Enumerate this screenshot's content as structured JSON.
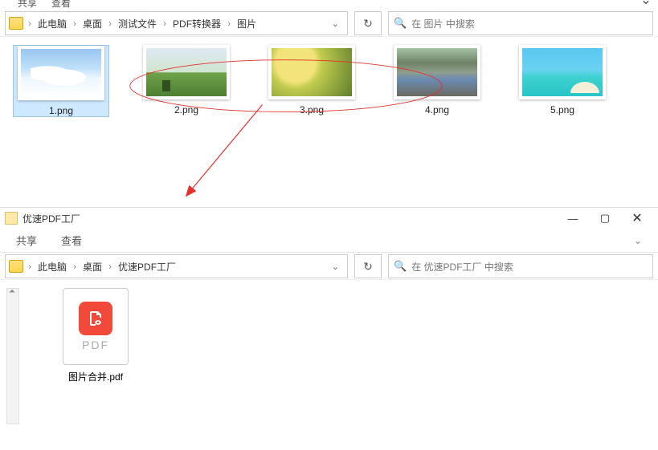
{
  "top": {
    "ribbonTabs": [
      "共享",
      "查看"
    ],
    "crumbs": [
      "此电脑",
      "桌面",
      "测试文件",
      "PDF转换器",
      "图片"
    ],
    "searchHint": "在 图片 中搜索",
    "files": [
      {
        "label": "1.png"
      },
      {
        "label": "2.png"
      },
      {
        "label": "3.png"
      },
      {
        "label": "4.png"
      },
      {
        "label": "5.png"
      }
    ]
  },
  "bottom": {
    "title": "优速PDF工厂",
    "ribbonTabs": [
      "共享",
      "查看"
    ],
    "crumbs": [
      "此电脑",
      "桌面",
      "优速PDF工厂"
    ],
    "searchHint": "在 优速PDF工厂 中搜索",
    "pdf": {
      "label": "图片合并.pdf",
      "ext": "PDF"
    }
  }
}
